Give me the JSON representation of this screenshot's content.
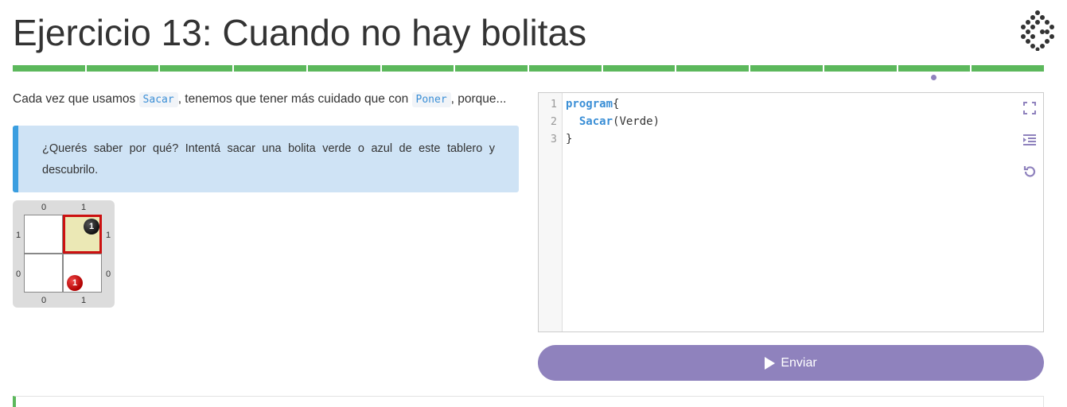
{
  "page": {
    "title": "Ejercicio 13: Cuando no hay bolitas"
  },
  "progress": {
    "total_steps": 14,
    "completed_steps": 14,
    "current_step": 13,
    "color_completed": "#5cb85c",
    "indicator_color": "#8f82bd"
  },
  "statement": {
    "intro_before": "Cada vez que usamos",
    "code_sacar": "Sacar",
    "intro_middle": ", tenemos que tener más cuidado que con",
    "code_poner": "Poner",
    "intro_after": ", porque...",
    "callout": "¿Querés saber por qué? Intentá sacar una bolita verde o azul de este tablero y descubrilo."
  },
  "board": {
    "columns": [
      "0",
      "1"
    ],
    "rows": [
      "1",
      "0"
    ],
    "cells": [
      {
        "row": "1",
        "col": "0",
        "selected": false,
        "balls": []
      },
      {
        "row": "1",
        "col": "1",
        "selected": true,
        "balls": [
          {
            "color": "black",
            "count": "1"
          }
        ]
      },
      {
        "row": "0",
        "col": "0",
        "selected": false,
        "balls": []
      },
      {
        "row": "0",
        "col": "1",
        "selected": false,
        "balls": [
          {
            "color": "red",
            "count": "1"
          }
        ]
      }
    ]
  },
  "editor": {
    "line_numbers": [
      "1",
      "2",
      "3"
    ],
    "lines": {
      "l1_kw": "program",
      "l1_rest": "{",
      "l2_indent": "  ",
      "l2_fn": "Sacar",
      "l2_rest": "(Verde)",
      "l3": "}"
    },
    "tools": [
      "fullscreen-icon",
      "indent-icon",
      "undo-icon"
    ]
  },
  "actions": {
    "send_label": "Enviar"
  },
  "colors": {
    "accent": "#8f82bd",
    "callout_bg": "#cfe3f5",
    "callout_border": "#3a9ee0",
    "code_keyword": "#3b8fd6"
  }
}
